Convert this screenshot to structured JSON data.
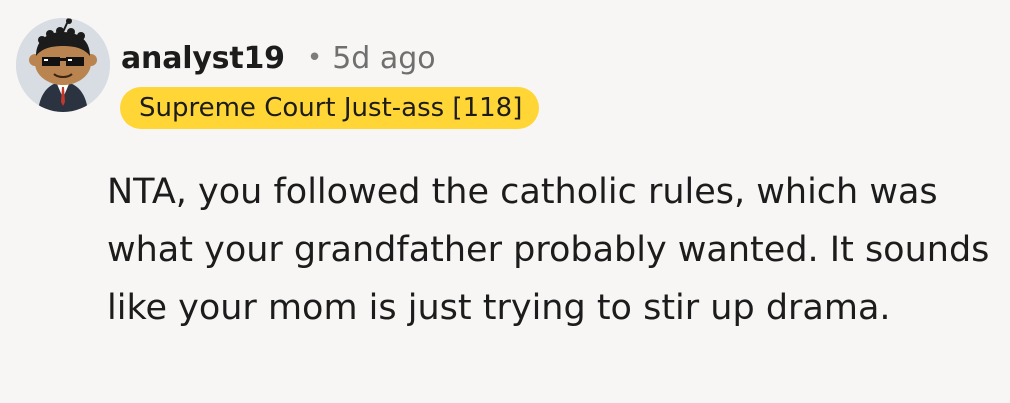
{
  "comment": {
    "avatar_icon": "snoo-avatar-sunglasses-icon",
    "username": "analyst19",
    "separator": "•",
    "timestamp": "5d ago",
    "flair": "Supreme Court Just-ass [118]",
    "body": "NTA, you followed the catholic rules, which was what your grandfather probably wanted. It sounds like your mom is just trying to stir up drama."
  },
  "colors": {
    "background": "#f8f6f5",
    "flair_background": "#ffd635",
    "text": "#1c1c1c",
    "muted_text": "#6f6f6f"
  }
}
